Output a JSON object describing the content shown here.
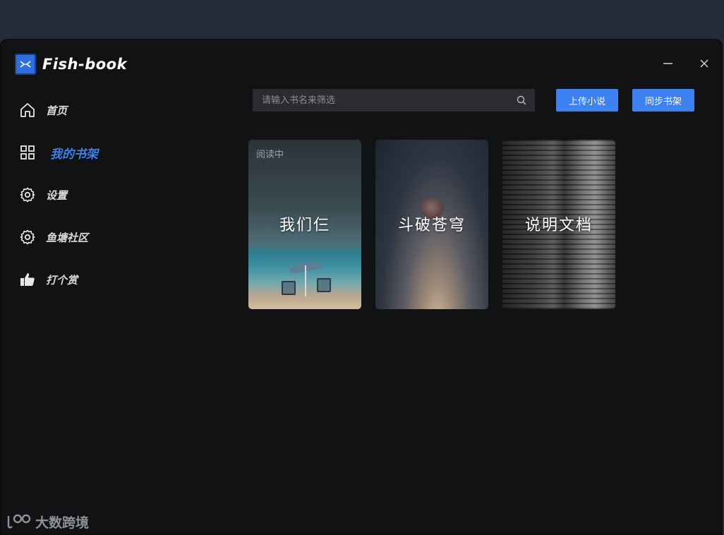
{
  "app": {
    "title": "Fish-book"
  },
  "window_controls": {
    "minimize_icon": "minus",
    "close_icon": "x"
  },
  "sidebar": {
    "items": [
      {
        "label": "首页",
        "icon": "home-icon",
        "active": false
      },
      {
        "label": "我的书架",
        "icon": "grid-icon",
        "active": true
      },
      {
        "label": "设置",
        "icon": "gear-icon",
        "active": false
      },
      {
        "label": "鱼塘社区",
        "icon": "gear-icon",
        "active": false
      },
      {
        "label": "打个赏",
        "icon": "thumbs-up-icon",
        "active": false
      }
    ]
  },
  "toolbar": {
    "search_placeholder": "请输入书名来筛选",
    "search_value": "",
    "upload_label": "上传小说",
    "sync_label": "同步书架"
  },
  "books": [
    {
      "title": "我们仨",
      "tag": "阅读中"
    },
    {
      "title": "斗破苍穹",
      "tag": ""
    },
    {
      "title": "说明文档",
      "tag": ""
    }
  ],
  "watermark": {
    "text": "大数跨境"
  },
  "colors": {
    "accent": "#3d82f0",
    "active_nav": "#3b82e8",
    "window_bg": "#101214",
    "desktop_bg": "#242d37"
  }
}
